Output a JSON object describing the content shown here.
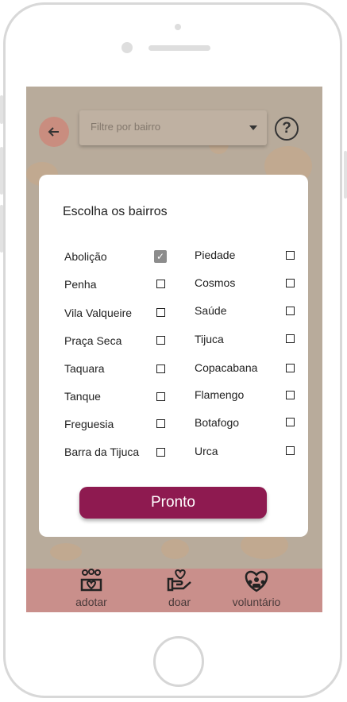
{
  "topbar": {
    "filter_placeholder": "Filtre por bairro",
    "help_label": "?"
  },
  "modal": {
    "title": "Escolha os bairros",
    "left_options": [
      {
        "label": "Abolição",
        "checked": true
      },
      {
        "label": "Penha",
        "checked": false
      },
      {
        "label": "Vila Valqueire",
        "checked": false
      },
      {
        "label": "Praça Seca",
        "checked": false
      },
      {
        "label": "Taquara",
        "checked": false
      },
      {
        "label": "Tanque",
        "checked": false
      },
      {
        "label": "Freguesia",
        "checked": false
      },
      {
        "label": "Barra da Tijuca",
        "checked": false
      }
    ],
    "right_options": [
      {
        "label": "Piedade",
        "checked": false
      },
      {
        "label": "Cosmos",
        "checked": false
      },
      {
        "label": "Saúde",
        "checked": false
      },
      {
        "label": "Tijuca",
        "checked": false
      },
      {
        "label": "Copacabana",
        "checked": false
      },
      {
        "label": "Flamengo",
        "checked": false
      },
      {
        "label": "Botafogo",
        "checked": false
      },
      {
        "label": "Urca",
        "checked": false
      }
    ],
    "confirm_label": "Pronto"
  },
  "bottom_nav": {
    "items": [
      {
        "label": "adotar",
        "icon": "adopt-icon"
      },
      {
        "label": "doar",
        "icon": "donate-icon"
      },
      {
        "label": "voluntário",
        "icon": "volunteer-icon"
      }
    ]
  },
  "colors": {
    "accent": "#8e1a50",
    "nav_bg": "#c98f8b",
    "back_button": "#c98d7f"
  }
}
